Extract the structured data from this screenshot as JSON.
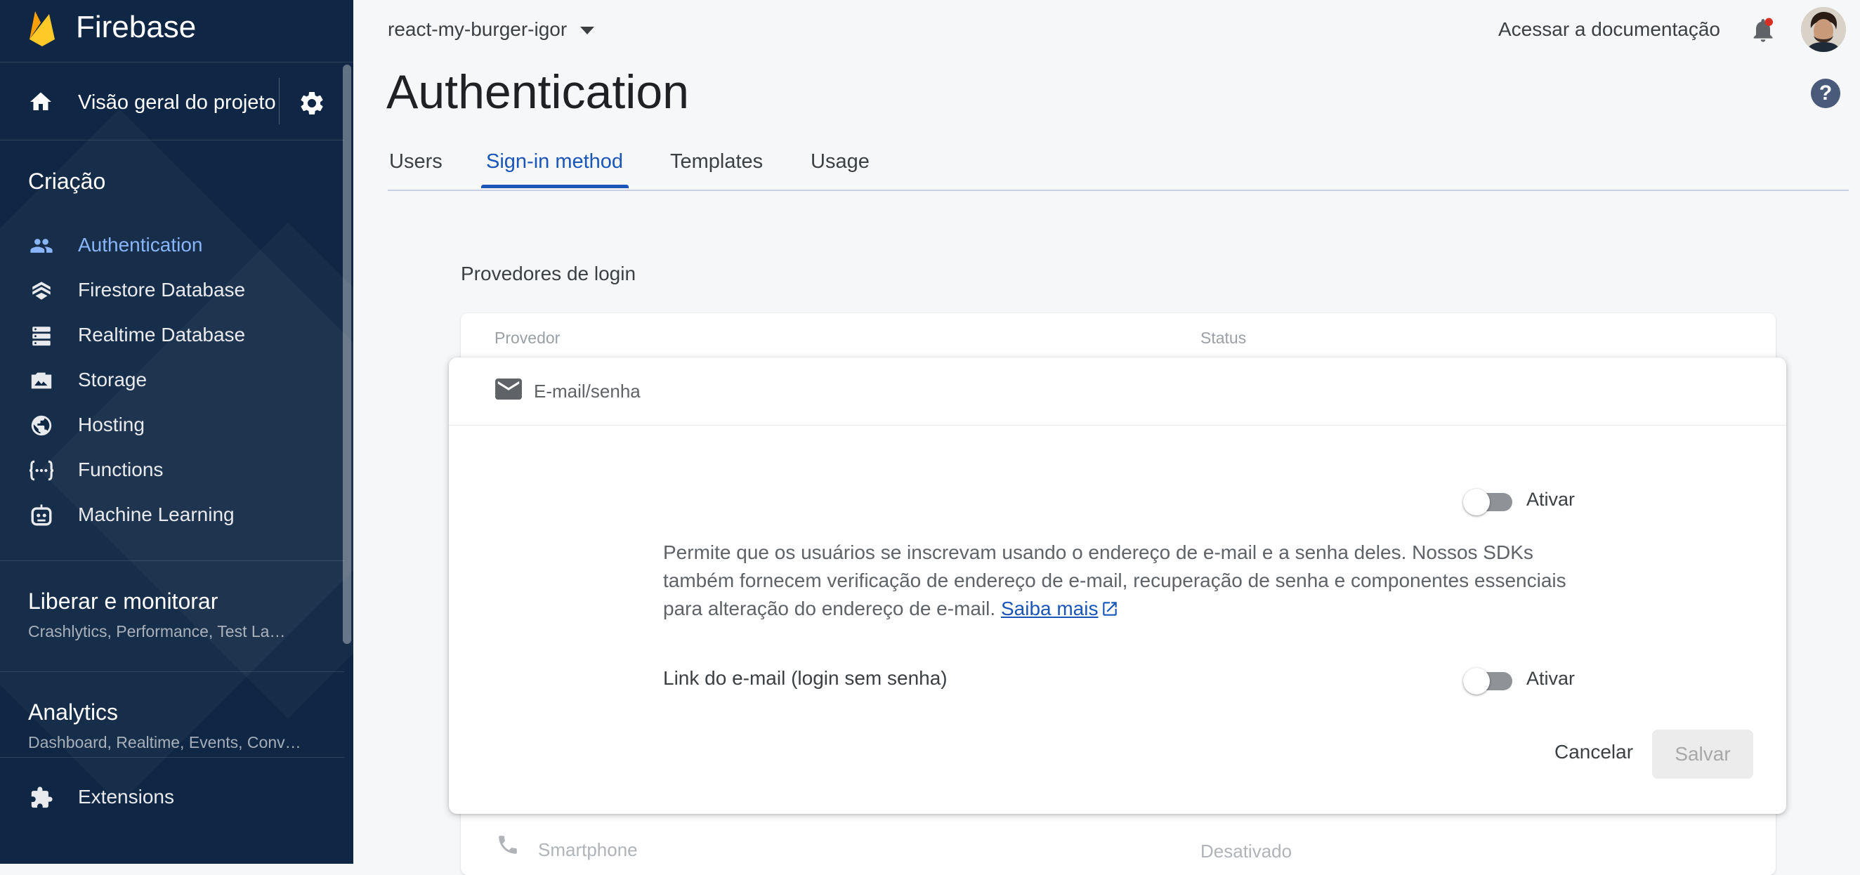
{
  "colors": {
    "sidebar_bg": "#0f2744",
    "accent": "#1a56b8",
    "active_nav": "#8ab4f8",
    "page_bg": "#f6f7f9"
  },
  "sidebar": {
    "brand": "Firebase",
    "overview_label": "Visão geral do projeto",
    "build_section": "Criação",
    "items": [
      {
        "label": "Authentication",
        "icon": "people-icon",
        "active": true
      },
      {
        "label": "Firestore Database",
        "icon": "firestore-icon"
      },
      {
        "label": "Realtime Database",
        "icon": "database-icon"
      },
      {
        "label": "Storage",
        "icon": "image-icon"
      },
      {
        "label": "Hosting",
        "icon": "globe-icon"
      },
      {
        "label": "Functions",
        "icon": "functions-icon"
      },
      {
        "label": "Machine Learning",
        "icon": "robot-icon"
      }
    ],
    "release": {
      "title": "Liberar e monitorar",
      "subtitle": "Crashlytics, Performance, Test La…"
    },
    "analytics": {
      "title": "Analytics",
      "subtitle": "Dashboard, Realtime, Events, Conv…"
    },
    "extensions": "Extensions"
  },
  "header": {
    "project": "react-my-burger-igor",
    "docs": "Acessar a documentação",
    "title": "Authentication"
  },
  "tabs": [
    {
      "label": "Users"
    },
    {
      "label": "Sign-in method",
      "active": true
    },
    {
      "label": "Templates"
    },
    {
      "label": "Usage"
    }
  ],
  "providers": {
    "title": "Provedores de login",
    "col_provider": "Provedor",
    "col_status": "Status",
    "bottom_row": {
      "name": "Smartphone",
      "status": "Desativado"
    }
  },
  "panel": {
    "provider_name": "E-mail/senha",
    "toggle1_label": "Ativar",
    "toggle1_on": false,
    "description": "Permite que os usuários se inscrevam usando o endereço de e-mail e a senha deles. Nossos SDKs também fornecem verificação de endereço de e-mail, recuperação de senha e componentes essenciais para alteração do endereço de e-mail.",
    "learn_more": "Saiba mais",
    "link_label": "Link do e-mail (login sem senha)",
    "toggle2_label": "Ativar",
    "toggle2_on": false,
    "cancel": "Cancelar",
    "save": "Salvar"
  }
}
